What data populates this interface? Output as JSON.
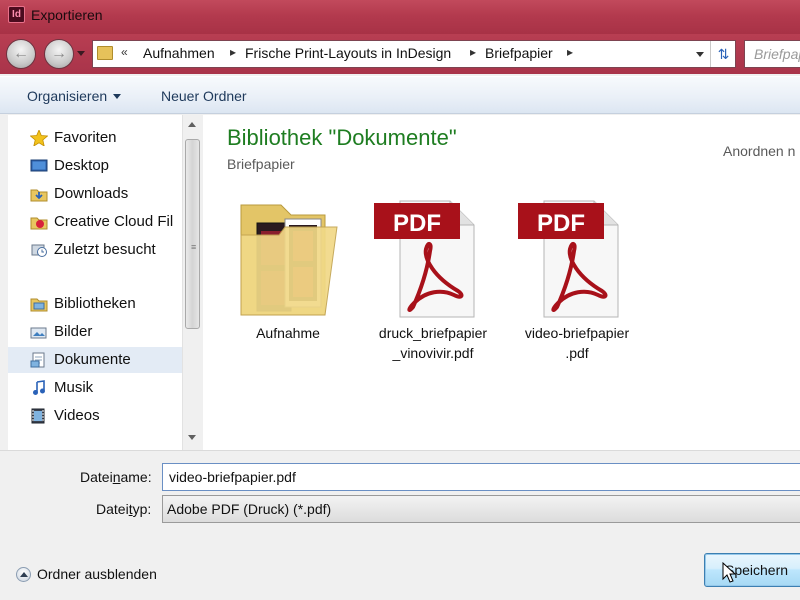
{
  "window": {
    "title": "Exportieren",
    "app_icon_label": "Id"
  },
  "breadcrumb": {
    "prefix": "«",
    "items": [
      "Aufnahmen",
      "Frische Print-Layouts in InDesign",
      "Briefpapier"
    ],
    "separator": "▸"
  },
  "search": {
    "placeholder": "Briefpap"
  },
  "toolbar": {
    "organize_label": "Organisieren",
    "new_folder_label": "Neuer Ordner"
  },
  "sidebar": {
    "items": [
      {
        "label": "Favoriten",
        "icon": "star-icon",
        "group": true
      },
      {
        "label": "Desktop",
        "icon": "desktop-icon"
      },
      {
        "label": "Downloads",
        "icon": "downloads-icon"
      },
      {
        "label": "Creative Cloud Fil",
        "icon": "creative-cloud-icon"
      },
      {
        "label": "Zuletzt besucht",
        "icon": "recent-places-icon"
      },
      {
        "label": "Bibliotheken",
        "icon": "libraries-icon",
        "group": true
      },
      {
        "label": "Bilder",
        "icon": "pictures-icon"
      },
      {
        "label": "Dokumente",
        "icon": "documents-icon",
        "selected": true
      },
      {
        "label": "Musik",
        "icon": "music-icon"
      },
      {
        "label": "Videos",
        "icon": "videos-icon"
      }
    ]
  },
  "content": {
    "library_title": "Bibliothek \"Dokumente\"",
    "subtitle": "Briefpapier",
    "arrange_label": "Anordnen n",
    "files": [
      {
        "name_line1": "Aufnahme",
        "name_line2": "",
        "icon": "folder-icon"
      },
      {
        "name_line1": "druck_briefpapier",
        "name_line2": "_vinovivir.pdf",
        "icon": "pdf-icon"
      },
      {
        "name_line1": "video-briefpapier",
        "name_line2": ".pdf",
        "icon": "pdf-icon"
      }
    ],
    "pdf_badge": "PDF"
  },
  "form": {
    "filename_label_pre": "Datei",
    "filename_label_u": "n",
    "filename_label_post": "ame:",
    "filename_value": "video-briefpapier.pdf",
    "filetype_label_pre": "Datei",
    "filetype_label_u": "t",
    "filetype_label_post": "yp:",
    "filetype_value": "Adobe PDF (Druck) (*.pdf)"
  },
  "footer": {
    "hide_folders_label": "Ordner ausblenden",
    "save_label": "Speichern"
  },
  "colors": {
    "title_bar": "#b33a4e",
    "library_title": "#1e7d21",
    "pdf_red": "#a8111a"
  }
}
